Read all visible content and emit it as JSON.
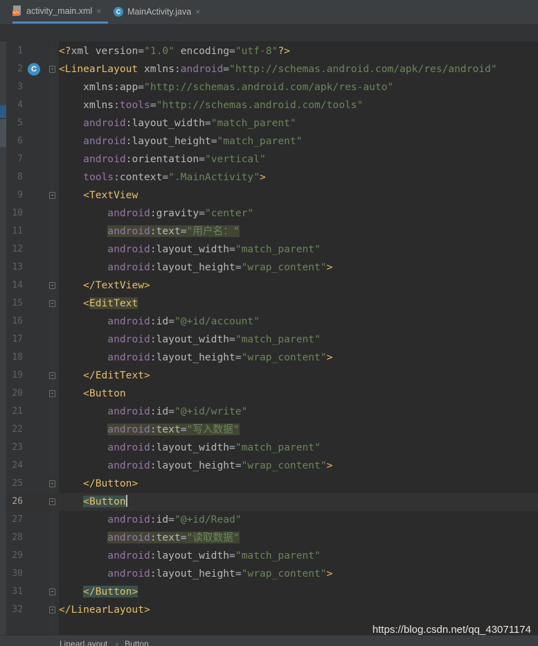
{
  "tabs": [
    {
      "label": "activity_main.xml",
      "active": true,
      "icon": "xml-file-icon"
    },
    {
      "label": "MainActivity.java",
      "active": false,
      "icon": "java-class-icon"
    }
  ],
  "tab_close_glyph": "×",
  "gutter_class_marker": "C",
  "current_line": 26,
  "lines": [
    {
      "n": "1",
      "tokens": [
        [
          "t-pi",
          "<?"
        ],
        [
          "t-attr",
          "xml version"
        ],
        [
          "",
          "="
        ],
        [
          "t-val",
          "\"1.0\""
        ],
        [
          "t-attr",
          " encoding"
        ],
        [
          "",
          "="
        ],
        [
          "t-val",
          "\"utf-8\""
        ],
        [
          "t-pi",
          "?>"
        ]
      ]
    },
    {
      "n": "2",
      "tokens": [
        [
          "t-tag",
          "<LinearLayout "
        ],
        [
          "t-attr",
          "xmlns:"
        ],
        [
          "t-ns",
          "android"
        ],
        [
          "",
          "="
        ],
        [
          "t-val",
          "\"http://schemas.android.com/apk/res/android\""
        ]
      ]
    },
    {
      "n": "3",
      "tokens": [
        [
          "",
          "    "
        ],
        [
          "t-attr",
          "xmlns:app"
        ],
        [
          "",
          "="
        ],
        [
          "t-val",
          "\"http://schemas.android.com/apk/res-auto\""
        ]
      ]
    },
    {
      "n": "4",
      "tokens": [
        [
          "",
          "    "
        ],
        [
          "t-attr",
          "xmlns:"
        ],
        [
          "t-ns",
          "tools"
        ],
        [
          "",
          "="
        ],
        [
          "t-val",
          "\"http://schemas.android.com/tools\""
        ]
      ]
    },
    {
      "n": "5",
      "tokens": [
        [
          "",
          "    "
        ],
        [
          "t-ns",
          "android"
        ],
        [
          "t-attr",
          ":layout_width"
        ],
        [
          "",
          "="
        ],
        [
          "t-val",
          "\"match_parent\""
        ]
      ]
    },
    {
      "n": "6",
      "tokens": [
        [
          "",
          "    "
        ],
        [
          "t-ns",
          "android"
        ],
        [
          "t-attr",
          ":layout_height"
        ],
        [
          "",
          "="
        ],
        [
          "t-val",
          "\"match_parent\""
        ]
      ]
    },
    {
      "n": "7",
      "tokens": [
        [
          "",
          "    "
        ],
        [
          "t-ns",
          "android"
        ],
        [
          "t-attr",
          ":orientation"
        ],
        [
          "",
          "="
        ],
        [
          "t-val",
          "\"vertical\""
        ]
      ]
    },
    {
      "n": "8",
      "tokens": [
        [
          "",
          "    "
        ],
        [
          "t-ns",
          "tools"
        ],
        [
          "t-attr",
          ":context"
        ],
        [
          "",
          "="
        ],
        [
          "t-val",
          "\".MainActivity\""
        ],
        [
          "t-tag",
          ">"
        ]
      ]
    },
    {
      "n": "9",
      "tokens": [
        [
          "",
          "    "
        ],
        [
          "t-tag",
          "<TextView"
        ]
      ]
    },
    {
      "n": "10",
      "tokens": [
        [
          "",
          "        "
        ],
        [
          "t-ns",
          "android"
        ],
        [
          "t-attr",
          ":gravity"
        ],
        [
          "",
          "="
        ],
        [
          "t-val",
          "\"center\""
        ]
      ]
    },
    {
      "n": "11",
      "tokens": [
        [
          "",
          "        "
        ],
        [
          "t-ns hl-warn",
          "android"
        ],
        [
          "t-attr hl-warn",
          ":text"
        ],
        [
          "hl-warn",
          "="
        ],
        [
          "t-val hl-warn",
          "\"用户名：\""
        ]
      ]
    },
    {
      "n": "12",
      "tokens": [
        [
          "",
          "        "
        ],
        [
          "t-ns",
          "android"
        ],
        [
          "t-attr",
          ":layout_width"
        ],
        [
          "",
          "="
        ],
        [
          "t-val",
          "\"match_parent\""
        ]
      ]
    },
    {
      "n": "13",
      "tokens": [
        [
          "",
          "        "
        ],
        [
          "t-ns",
          "android"
        ],
        [
          "t-attr",
          ":layout_height"
        ],
        [
          "",
          "="
        ],
        [
          "t-val",
          "\"wrap_content\""
        ],
        [
          "t-tag",
          ">"
        ]
      ]
    },
    {
      "n": "14",
      "tokens": [
        [
          "",
          "    "
        ],
        [
          "t-tag",
          "</TextView>"
        ]
      ]
    },
    {
      "n": "15",
      "tokens": [
        [
          "",
          "    "
        ],
        [
          "t-tag",
          "<"
        ],
        [
          "t-tag hl-warn",
          "EditText"
        ]
      ]
    },
    {
      "n": "16",
      "tokens": [
        [
          "",
          "        "
        ],
        [
          "t-ns",
          "android"
        ],
        [
          "t-attr",
          ":id"
        ],
        [
          "",
          "="
        ],
        [
          "t-val",
          "\"@+id/account\""
        ]
      ]
    },
    {
      "n": "17",
      "tokens": [
        [
          "",
          "        "
        ],
        [
          "t-ns",
          "android"
        ],
        [
          "t-attr",
          ":layout_width"
        ],
        [
          "",
          "="
        ],
        [
          "t-val",
          "\"match_parent\""
        ]
      ]
    },
    {
      "n": "18",
      "tokens": [
        [
          "",
          "        "
        ],
        [
          "t-ns",
          "android"
        ],
        [
          "t-attr",
          ":layout_height"
        ],
        [
          "",
          "="
        ],
        [
          "t-val",
          "\"wrap_content\""
        ],
        [
          "t-tag",
          ">"
        ]
      ]
    },
    {
      "n": "19",
      "tokens": [
        [
          "",
          "    "
        ],
        [
          "t-tag",
          "</EditText>"
        ]
      ]
    },
    {
      "n": "20",
      "tokens": [
        [
          "",
          "    "
        ],
        [
          "t-tag",
          "<Button"
        ]
      ]
    },
    {
      "n": "21",
      "tokens": [
        [
          "",
          "        "
        ],
        [
          "t-ns",
          "android"
        ],
        [
          "t-attr",
          ":id"
        ],
        [
          "",
          "="
        ],
        [
          "t-val",
          "\"@+id/write\""
        ]
      ]
    },
    {
      "n": "22",
      "tokens": [
        [
          "",
          "        "
        ],
        [
          "t-ns hl-warn",
          "android"
        ],
        [
          "t-attr hl-warn",
          ":text"
        ],
        [
          "hl-warn",
          "="
        ],
        [
          "t-val hl-warn",
          "\"写入数据\""
        ]
      ]
    },
    {
      "n": "23",
      "tokens": [
        [
          "",
          "        "
        ],
        [
          "t-ns",
          "android"
        ],
        [
          "t-attr",
          ":layout_width"
        ],
        [
          "",
          "="
        ],
        [
          "t-val",
          "\"match_parent\""
        ]
      ]
    },
    {
      "n": "24",
      "tokens": [
        [
          "",
          "        "
        ],
        [
          "t-ns",
          "android"
        ],
        [
          "t-attr",
          ":layout_height"
        ],
        [
          "",
          "="
        ],
        [
          "t-val",
          "\"wrap_content\""
        ],
        [
          "t-tag",
          ">"
        ]
      ]
    },
    {
      "n": "25",
      "tokens": [
        [
          "",
          "    "
        ],
        [
          "t-tag",
          "</Button>"
        ]
      ]
    },
    {
      "n": "26",
      "tokens": [
        [
          "",
          "    "
        ],
        [
          "t-tag hl-match",
          "<Button"
        ],
        [
          "caret",
          ""
        ]
      ]
    },
    {
      "n": "27",
      "tokens": [
        [
          "",
          "        "
        ],
        [
          "t-ns",
          "android"
        ],
        [
          "t-attr",
          ":id"
        ],
        [
          "",
          "="
        ],
        [
          "t-val",
          "\"@+id/Read\""
        ]
      ]
    },
    {
      "n": "28",
      "tokens": [
        [
          "",
          "        "
        ],
        [
          "t-ns hl-warn",
          "android"
        ],
        [
          "t-attr hl-warn",
          ":text"
        ],
        [
          "hl-warn",
          "="
        ],
        [
          "t-val hl-warn",
          "\"读取数据\""
        ]
      ]
    },
    {
      "n": "29",
      "tokens": [
        [
          "",
          "        "
        ],
        [
          "t-ns",
          "android"
        ],
        [
          "t-attr",
          ":layout_width"
        ],
        [
          "",
          "="
        ],
        [
          "t-val",
          "\"match_parent\""
        ]
      ]
    },
    {
      "n": "30",
      "tokens": [
        [
          "",
          "        "
        ],
        [
          "t-ns",
          "android"
        ],
        [
          "t-attr",
          ":layout_height"
        ],
        [
          "",
          "="
        ],
        [
          "t-val",
          "\"wrap_content\""
        ],
        [
          "t-tag",
          ">"
        ]
      ]
    },
    {
      "n": "31",
      "tokens": [
        [
          "",
          "    "
        ],
        [
          "t-tag hl-match",
          "</Button>"
        ]
      ]
    },
    {
      "n": "32",
      "tokens": [
        [
          "t-tag",
          "</LinearLayout>"
        ]
      ]
    }
  ],
  "fold_lines": [
    "2",
    "9",
    "14",
    "15",
    "19",
    "20",
    "25",
    "26",
    "31",
    "32"
  ],
  "breadcrumb": [
    "LinearLayout",
    "Button"
  ],
  "breadcrumb_separator": "›",
  "watermark": "https://blog.csdn.net/qq_43071174",
  "colors": {
    "background": "#2b2b2b",
    "tag": "#e8bf6a",
    "namespace": "#9876aa",
    "attribute": "#bababa",
    "value": "#6a8759",
    "line_number": "#606366",
    "accent": "#4a88c7"
  }
}
